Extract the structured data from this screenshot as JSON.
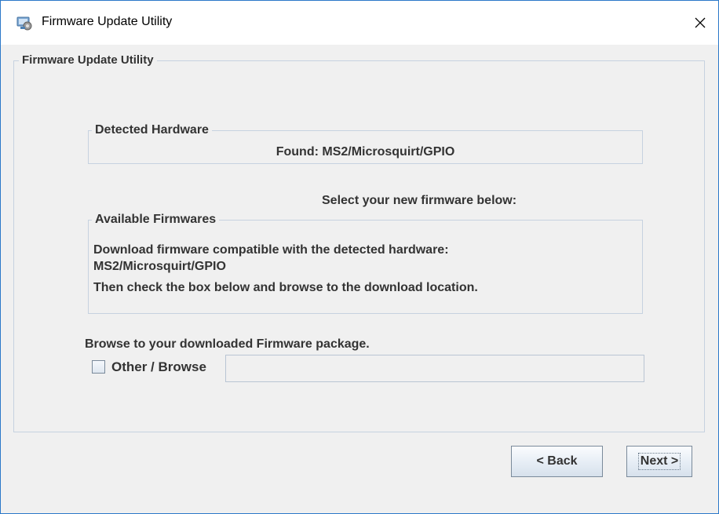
{
  "window": {
    "title": "Firmware Update Utility",
    "close_glyph": "✕",
    "icon": "app-icon"
  },
  "main_group": {
    "legend": "Firmware Update Utility"
  },
  "detected_hardware": {
    "legend": "Detected Hardware",
    "found_text": "Found: MS2/Microsquirt/GPIO"
  },
  "select_prompt": "Select your new firmware below:",
  "available_firmwares": {
    "legend": "Available Firmwares",
    "lines": [
      "Download firmware compatible with the detected hardware:",
      "MS2/Microsquirt/GPIO",
      "Then check the box below and browse to the download location."
    ]
  },
  "browse": {
    "instruction": "Browse to your downloaded Firmware package.",
    "checkbox_label": "Other / Browse",
    "checkbox_checked": false,
    "path_value": ""
  },
  "buttons": {
    "back_label": "< Back",
    "next_label": "Next >"
  },
  "colors": {
    "window_border": "#2b78c9",
    "panel_bg": "#f0f0f0",
    "group_border": "#c6d2e0",
    "text": "#333333"
  }
}
